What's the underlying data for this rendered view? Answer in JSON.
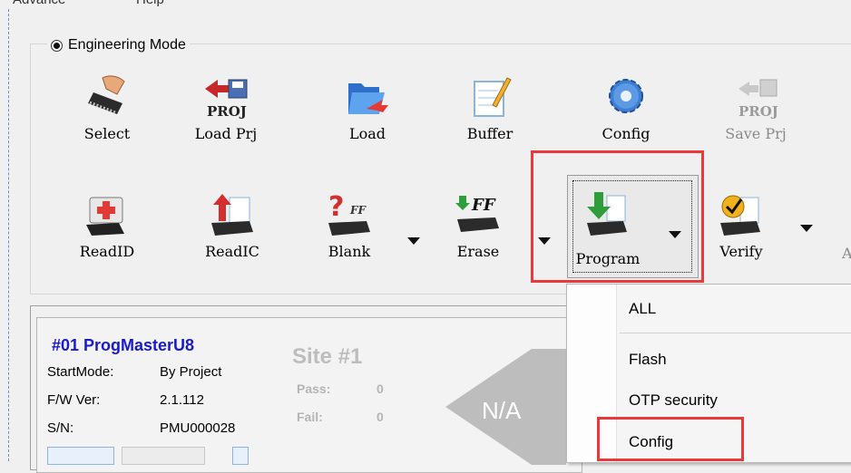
{
  "menubar": {
    "items": [
      "Advance",
      "Help"
    ]
  },
  "mode": {
    "label": "Engineering Mode"
  },
  "toolbar_row1": [
    {
      "label": "Select",
      "icon": "hand-chip-icon"
    },
    {
      "label": "Load Prj",
      "icon": "load-project-icon",
      "badge": "PROJ"
    },
    {
      "label": "Load",
      "icon": "folder-open-icon"
    },
    {
      "label": "Buffer",
      "icon": "buffer-edit-icon"
    },
    {
      "label": "Config",
      "icon": "gear-icon"
    },
    {
      "label": "Save Prj",
      "icon": "save-project-icon",
      "badge": "PROJ",
      "disabled": true
    }
  ],
  "toolbar_row2": [
    {
      "label": "ReadID",
      "icon": "first-aid-chip-icon"
    },
    {
      "label": "ReadIC",
      "icon": "read-ic-icon"
    },
    {
      "label": "Blank",
      "icon": "blank-check-icon",
      "badge": "?FF"
    },
    {
      "label": "Erase",
      "icon": "erase-icon",
      "badge": "FF"
    },
    {
      "label": "Program",
      "icon": "program-icon"
    },
    {
      "label": "Verify",
      "icon": "verify-icon"
    }
  ],
  "toolbar_overflow_char": "A",
  "program_menu": {
    "items": [
      "ALL",
      "Flash",
      "OTP security",
      "Config"
    ]
  },
  "site": {
    "programmer_name": "#01 ProgMasterU8",
    "start_mode_label": "StartMode:",
    "start_mode_value": "By Project",
    "fw_label": "F/W Ver:",
    "fw_value": "2.1.112",
    "sn_label": "S/N:",
    "sn_value": "PMU000028",
    "title": "Site #1",
    "pass_label": "Pass:",
    "pass_value": "0",
    "fail_label": "Fail:",
    "fail_value": "0",
    "status": "N/A"
  },
  "colors": {
    "highlight": "#e83a3a",
    "programmer_name": "#1a1acc"
  }
}
